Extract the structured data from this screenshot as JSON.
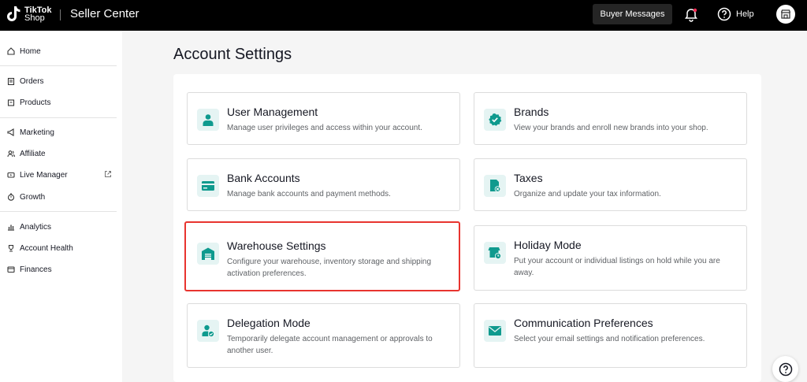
{
  "topbar": {
    "logo_line1": "TikTok",
    "logo_line2": "Shop",
    "app_title": "Seller Center",
    "buyer_messages": "Buyer Messages",
    "help_label": "Help"
  },
  "sidebar": {
    "items": [
      {
        "label": "Home",
        "icon": "home-icon"
      },
      {
        "label": "Orders",
        "icon": "clipboard-icon"
      },
      {
        "label": "Products",
        "icon": "box-icon"
      },
      {
        "label": "Marketing",
        "icon": "megaphone-icon"
      },
      {
        "label": "Affiliate",
        "icon": "users-icon"
      },
      {
        "label": "Live Manager",
        "icon": "video-icon"
      },
      {
        "label": "Growth",
        "icon": "stopwatch-icon"
      },
      {
        "label": "Analytics",
        "icon": "bar-chart-icon"
      },
      {
        "label": "Account Health",
        "icon": "trophy-icon"
      },
      {
        "label": "Finances",
        "icon": "wallet-icon"
      }
    ]
  },
  "main": {
    "page_title": "Account Settings",
    "cards": [
      {
        "title": "User Management",
        "desc": "Manage user privileges and access within your account.",
        "icon": "user-icon"
      },
      {
        "title": "Brands",
        "desc": "View your brands and enroll new brands into your shop.",
        "icon": "verified-badge-icon"
      },
      {
        "title": "Bank Accounts",
        "desc": "Manage bank accounts and payment methods.",
        "icon": "card-icon"
      },
      {
        "title": "Taxes",
        "desc": "Organize and update your tax information.",
        "icon": "tax-document-icon"
      },
      {
        "title": "Warehouse Settings",
        "desc": "Configure your warehouse, inventory storage and shipping activation preferences.",
        "icon": "warehouse-icon"
      },
      {
        "title": "Holiday Mode",
        "desc": "Put your account or individual listings on hold while you are away.",
        "icon": "store-clock-icon"
      },
      {
        "title": "Delegation Mode",
        "desc": "Temporarily delegate account management or approvals to another user.",
        "icon": "user-check-icon"
      },
      {
        "title": "Communication Preferences",
        "desc": "Select your email settings and notification preferences.",
        "icon": "envelope-icon"
      }
    ]
  },
  "colors": {
    "accent_teal": "#0f9a8e",
    "selection_red": "#e8342f",
    "notification_dot": "#fe2c55"
  }
}
